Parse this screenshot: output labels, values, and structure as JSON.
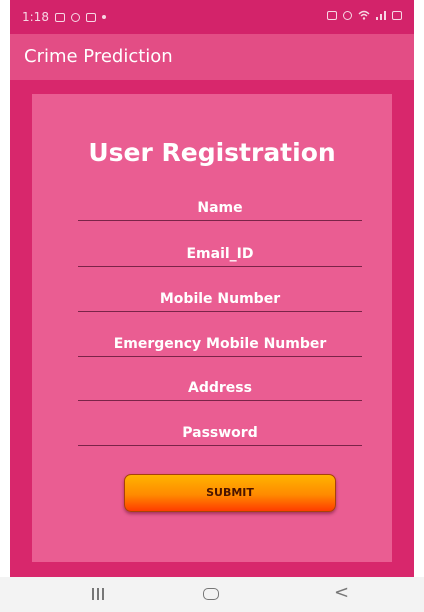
{
  "status_bar": {
    "time": "1:18"
  },
  "app_bar": {
    "title": "Crime Prediction"
  },
  "form": {
    "title": "User Registration",
    "fields": [
      {
        "label": "Name"
      },
      {
        "label": "Email_ID"
      },
      {
        "label": "Mobile Number"
      },
      {
        "label": "Emergency Mobile Number"
      },
      {
        "label": "Address"
      },
      {
        "label": "Password"
      }
    ],
    "submit_label": "SUBMIT"
  },
  "colors": {
    "background": "#d8276c",
    "app_bar": "#e34d85",
    "card": "#ea5d92",
    "submit_gradient_top": "#ffb300",
    "submit_gradient_bottom": "#ff3c00"
  },
  "nav_bar": {
    "icons": [
      "recent-apps-icon",
      "home-icon",
      "back-icon"
    ]
  }
}
